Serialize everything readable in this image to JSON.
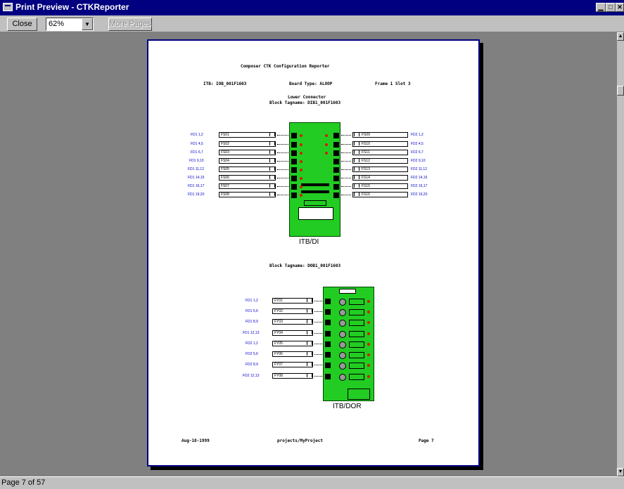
{
  "window": {
    "title": "Print Preview - CTKReporter",
    "minimize_symbol": "▁",
    "maximize_symbol": "□",
    "close_symbol": "✕"
  },
  "toolbar": {
    "close_label": "Close",
    "zoom_value": "62%",
    "more_pages_label": "More Pages"
  },
  "status": {
    "text": "Page 7 of 57"
  },
  "report": {
    "title": "Composer CTK Configuration Reporter",
    "itb": "ITB: IOB_001F1603",
    "board_type": "Board Type: ALOOP",
    "frame_slot": "Frame 1 Slot 3",
    "connector": "Lower Connector",
    "block1": "Block Tagname: DIB1_001F1603",
    "board1_caption": "ITB/DI",
    "block2": "Block Tagname: DOB1_001F1603",
    "board2_caption": "ITB/DOR",
    "footer_date": "Aug-18-1999",
    "footer_path": "projects/MyProject",
    "footer_page": "Page 7",
    "left_di": [
      {
        "pins": "FD1 1,2",
        "tag": "FS01"
      },
      {
        "pins": "FD1 4,5",
        "tag": "FS02"
      },
      {
        "pins": "FD1 6,7",
        "tag": "FS03"
      },
      {
        "pins": "FD1 9,10",
        "tag": "FS04"
      },
      {
        "pins": "FD1 11,12",
        "tag": "FS05"
      },
      {
        "pins": "FD1 14,15",
        "tag": "FS06"
      },
      {
        "pins": "FD1 16,17",
        "tag": "FS07"
      },
      {
        "pins": "FD1 19,20",
        "tag": "FS08"
      }
    ],
    "right_di": [
      {
        "pins": "FD2 1,2",
        "tag": "FS09"
      },
      {
        "pins": "FD2 4,5",
        "tag": "FS10"
      },
      {
        "pins": "FD2 6,7",
        "tag": "FS11"
      },
      {
        "pins": "FD2 9,10",
        "tag": "FS12"
      },
      {
        "pins": "FD2 11,12",
        "tag": "FS13"
      },
      {
        "pins": "FD2 14,15",
        "tag": "FS14"
      },
      {
        "pins": "FD2 16,17",
        "tag": "FS15"
      },
      {
        "pins": "FD2 19,20",
        "tag": "FS16"
      }
    ],
    "dor": [
      {
        "pins": "FD1 1,2",
        "tag": "FY01"
      },
      {
        "pins": "FD1 5,6",
        "tag": "FY02"
      },
      {
        "pins": "FD1 8,9",
        "tag": "FY03"
      },
      {
        "pins": "FD1 12,13",
        "tag": "FY04"
      },
      {
        "pins": "FD2 1,2",
        "tag": "FY05"
      },
      {
        "pins": "FD2 5,6",
        "tag": "FY06"
      },
      {
        "pins": "FD2 8,9",
        "tag": "FY07"
      },
      {
        "pins": "FD2 12,13",
        "tag": "FY08"
      }
    ]
  },
  "colors": {
    "titlebar": "#000080",
    "board": "#22cc22",
    "pin_labels": "#0000cc",
    "leds": "#cc2200"
  }
}
